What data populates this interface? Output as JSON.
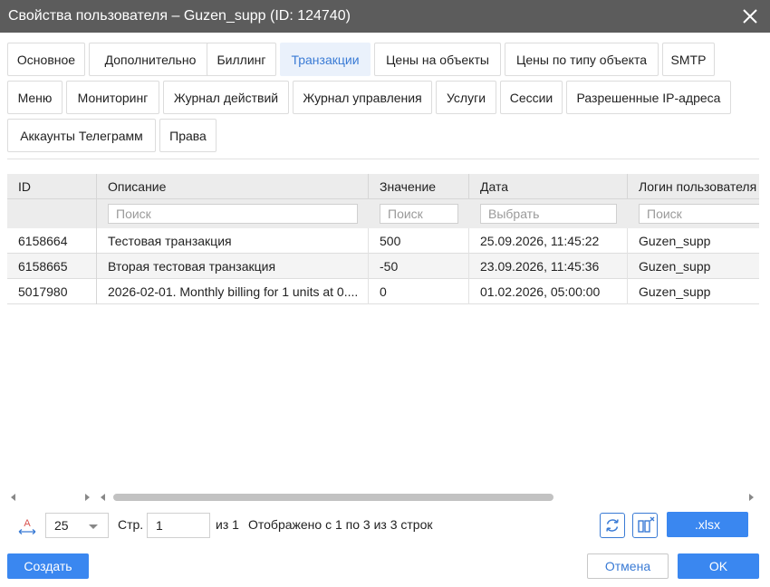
{
  "window": {
    "title": "Свойства пользователя – Guzen_supp (ID: 124740)"
  },
  "tabs": [
    {
      "label": "Основное"
    },
    {
      "label": "Дополнительно"
    },
    {
      "label": "Биллинг"
    },
    {
      "label": "Транзакции",
      "active": true
    },
    {
      "label": "Цены на объекты"
    },
    {
      "label": "Цены по типу объекта"
    },
    {
      "label": "SMTP"
    },
    {
      "label": "Меню"
    },
    {
      "label": "Мониторинг"
    },
    {
      "label": "Журнал действий"
    },
    {
      "label": "Журнал управления"
    },
    {
      "label": "Услуги"
    },
    {
      "label": "Сессии"
    },
    {
      "label": "Разрешенные IP-адреса"
    },
    {
      "label": "Аккаунты Телеграмм"
    },
    {
      "label": "Права"
    }
  ],
  "table": {
    "columns": [
      {
        "label": "ID"
      },
      {
        "label": "Описание",
        "filter": "Поиск"
      },
      {
        "label": "Значение",
        "filter": "Поиск"
      },
      {
        "label": "Дата",
        "filter": "Выбрать"
      },
      {
        "label": "Логин пользователя",
        "filter": "Поиск"
      }
    ],
    "rows": [
      {
        "id": "6158664",
        "description": "Тестовая транзакция",
        "value": "500",
        "date": "25.09.2026, 11:45:22",
        "login": "Guzen_supp"
      },
      {
        "id": "6158665",
        "description": "Вторая тестовая транзакция",
        "value": "-50",
        "date": "23.09.2026, 11:45:36",
        "login": "Guzen_supp"
      },
      {
        "id": "5017980",
        "description": "2026-02-01. Monthly billing for 1 units at 0....",
        "value": "0",
        "date": "01.02.2026, 05:00:00",
        "login": "Guzen_supp"
      }
    ]
  },
  "pager": {
    "page_size": "25",
    "page_label": "Стр.",
    "page_value": "1",
    "of_label": "из 1",
    "summary": "Отображено с 1 по 3 из 3 строк",
    "export_label": ".xlsx"
  },
  "footer": {
    "create_label": "Создать",
    "cancel_label": "Отмена",
    "ok_label": "OK"
  },
  "colors": {
    "accent": "#3a87f0",
    "active_tab_bg": "#eaf1fb",
    "active_tab_text": "#3a7bd5",
    "titlebar": "#5c5c5c"
  },
  "icons": [
    "close-icon",
    "font-size-icon",
    "refresh-icon",
    "columns-icon",
    "chevron-down-icon",
    "arrow-left-icon",
    "arrow-right-icon"
  ]
}
